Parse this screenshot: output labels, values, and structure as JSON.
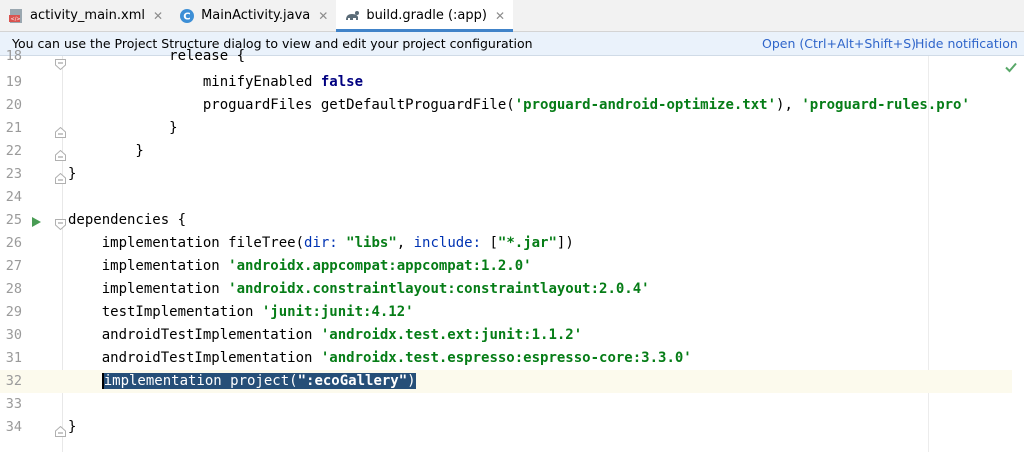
{
  "tabs": [
    {
      "label": "activity_main.xml",
      "icon": "xml-file-icon",
      "active": false
    },
    {
      "label": "MainActivity.java",
      "icon": "java-class-icon",
      "active": false
    },
    {
      "label": "build.gradle (:app)",
      "icon": "gradle-icon",
      "active": true
    }
  ],
  "notification": {
    "message": "You can use the Project Structure dialog to view and edit your project configuration",
    "open_link": "Open (Ctrl+Alt+Shift+S)",
    "hide_link": "Hide notification"
  },
  "lines": [
    {
      "num": "18",
      "text": "            release {"
    },
    {
      "num": "19",
      "text": "                minifyEnabled false"
    },
    {
      "num": "20",
      "text": "                proguardFiles getDefaultProguardFile('proguard-android-optimize.txt'), 'proguard-rules.pro'"
    },
    {
      "num": "21",
      "text": "            }"
    },
    {
      "num": "22",
      "text": "        }"
    },
    {
      "num": "23",
      "text": "}"
    },
    {
      "num": "24",
      "text": ""
    },
    {
      "num": "25",
      "text": "dependencies {"
    },
    {
      "num": "26",
      "text": "    implementation fileTree(dir: \"libs\", include: [\"*.jar\"])"
    },
    {
      "num": "27",
      "text": "    implementation 'androidx.appcompat:appcompat:1.2.0'"
    },
    {
      "num": "28",
      "text": "    implementation 'androidx.constraintlayout:constraintlayout:2.0.4'"
    },
    {
      "num": "29",
      "text": "    testImplementation 'junit:junit:4.12'"
    },
    {
      "num": "30",
      "text": "    androidTestImplementation 'androidx.test.ext:junit:1.1.2'"
    },
    {
      "num": "31",
      "text": "    androidTestImplementation 'androidx.test.espresso:espresso-core:3.3.0'"
    },
    {
      "num": "32",
      "text": "    implementation project(\":ecoGallery\")"
    },
    {
      "num": "33",
      "text": ""
    },
    {
      "num": "34",
      "text": "}"
    }
  ],
  "colors": {
    "keyword": "#000080",
    "string": "#067d17",
    "selection": "#264f78",
    "current_line": "#fcfaed",
    "link": "#2f65ca",
    "run_icon": "#499c54",
    "check_icon": "#59a869"
  }
}
